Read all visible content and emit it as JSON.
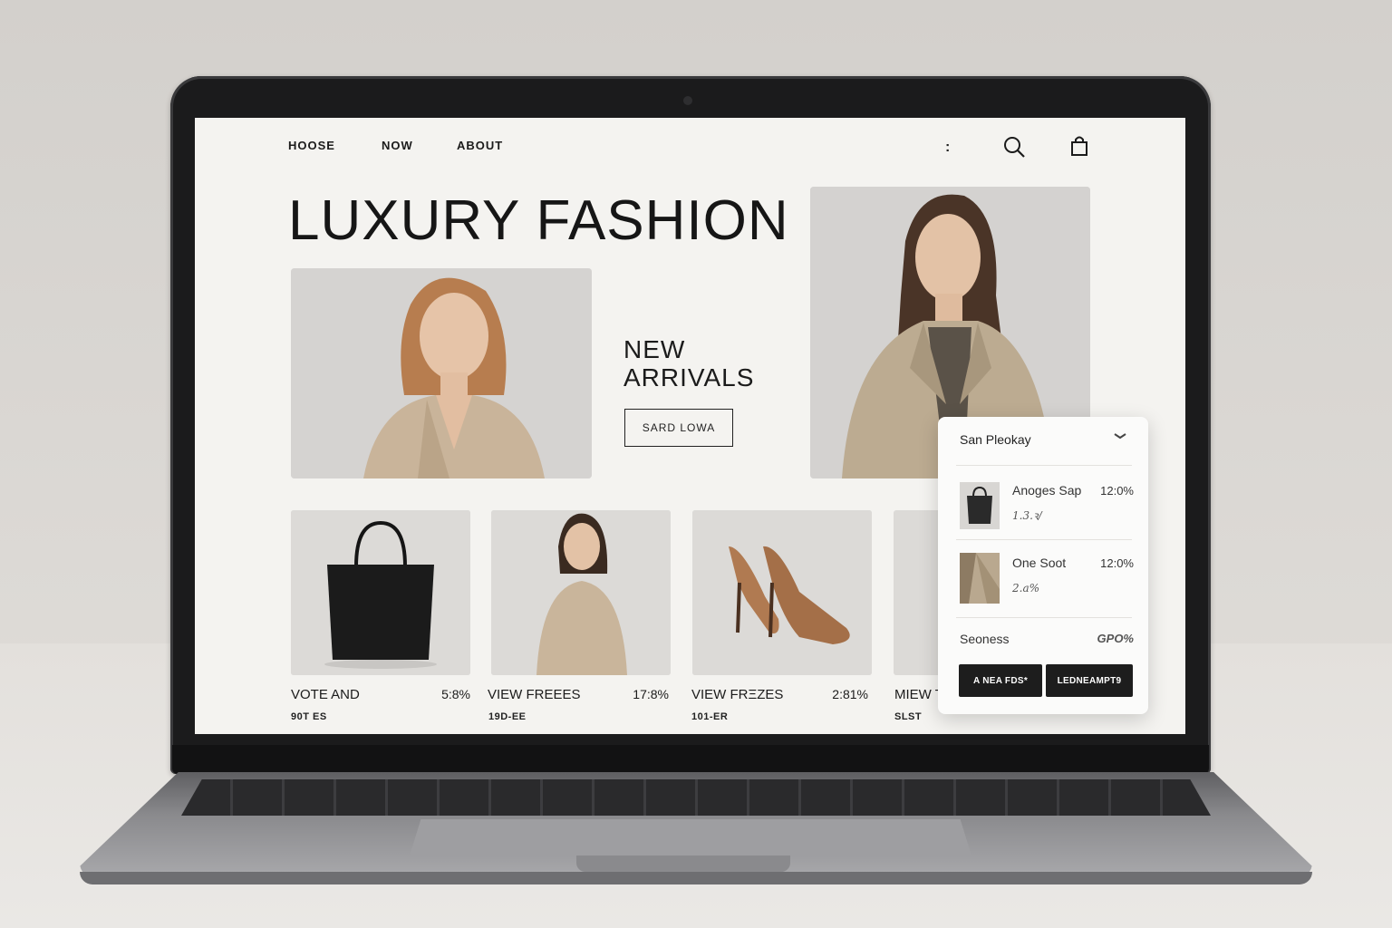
{
  "nav": {
    "links": [
      "HOOSE",
      "NOW",
      "ABOUT"
    ],
    "more": ":"
  },
  "hero": {
    "title": "LUXURY FASHION"
  },
  "new_arrivals": {
    "line1": "NEW",
    "line2": "ARRIVALS",
    "button": "SARD LOWA"
  },
  "products": [
    {
      "name": "VOTE AND",
      "price": "5:8%",
      "sub": "90T ES"
    },
    {
      "name": "VIEW FREЕES",
      "price": "17:8%",
      "sub": "19D-EE"
    },
    {
      "name": "VIEW FRΞZES",
      "price": "2:81%",
      "sub": "101-ER"
    },
    {
      "name": "MIEW T",
      "price": "",
      "sub": "SLST"
    }
  ],
  "cart": {
    "title": "San Pleokay",
    "items": [
      {
        "name": "Anoges Sap",
        "price": "12:0%",
        "sub": "1.3.ꝛ/"
      },
      {
        "name": "One Soot",
        "price": "12:0%",
        "sub": "2.a%"
      }
    ],
    "total_label": "Seoness",
    "total_value": "GPO%",
    "buttons": [
      "A NEA FDS*",
      "LEDNEAMPT9"
    ]
  },
  "colors": {
    "accent": "#1d1d1d",
    "background": "#f4f3f0",
    "coat": "#b9a88f"
  },
  "icons": [
    "search-icon",
    "bag-icon",
    "chevron-down-icon"
  ]
}
